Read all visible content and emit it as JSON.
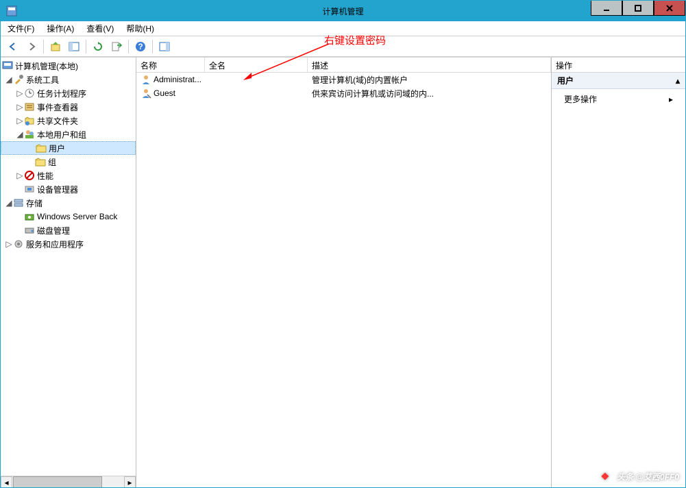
{
  "window": {
    "title": "计算机管理"
  },
  "menu": {
    "file": "文件(F)",
    "action": "操作(A)",
    "view": "查看(V)",
    "help": "帮助(H)"
  },
  "tree": {
    "root": "计算机管理(本地)",
    "system_tools": "系统工具",
    "task_scheduler": "任务计划程序",
    "event_viewer": "事件查看器",
    "shared_folders": "共享文件夹",
    "local_users_groups": "本地用户和组",
    "users": "用户",
    "groups": "组",
    "performance": "性能",
    "device_manager": "设备管理器",
    "storage": "存储",
    "windows_server_backup": "Windows Server Back",
    "disk_management": "磁盘管理",
    "services_apps": "服务和应用程序"
  },
  "columns": {
    "name": "名称",
    "fullname": "全名",
    "description": "描述"
  },
  "users_list": [
    {
      "name": "Administrat...",
      "fullname": "",
      "description": "管理计算机(域)的内置帐户"
    },
    {
      "name": "Guest",
      "fullname": "",
      "description": "供来宾访问计算机或访问域的内..."
    }
  ],
  "actions": {
    "header": "操作",
    "section": "用户",
    "more": "更多操作"
  },
  "annotation": "右键设置密码",
  "watermark": "头条 @艾西0FF0"
}
